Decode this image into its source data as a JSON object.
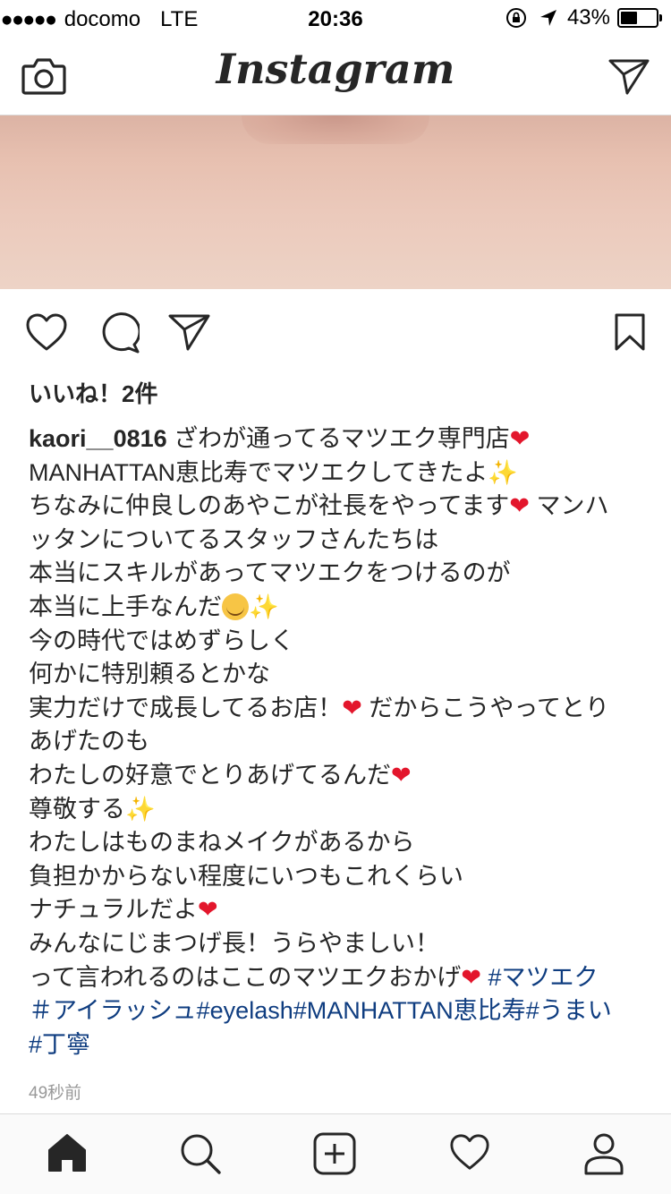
{
  "status_bar": {
    "signal": "●●●●●",
    "carrier": "docomo",
    "network": "LTE",
    "time": "20:36",
    "battery_percent": "43%",
    "battery_level": 0.43
  },
  "header": {
    "title": "Instagram",
    "left_icon": "camera-icon",
    "right_icon": "direct-message-icon"
  },
  "post": {
    "actions": [
      "like-icon",
      "comment-icon",
      "share-icon",
      "bookmark-icon"
    ],
    "likes_text": "いいね！2件",
    "caption": {
      "username": "kaori__0816",
      "line1_text": " ざわが通ってるマツエク専門店",
      "line2_text": "MANHATTAN恵比寿でマツエクしてきたよ",
      "line3a_text": "ちなみに仲良しのあやこが社長をやってます",
      "line3b_text": " マンハ",
      "line4_text": "ッタンについてるスタッフさんたちは",
      "line5_text": "本当にスキルがあってマツエクをつけるのが",
      "line6_text": "本当に上手なんだ",
      "line7_text": "今の時代ではめずらしく",
      "line8_text": "何かに特別頼るとかな",
      "line9a_text": "実力だけで成長してるお店！",
      "line9b_text": " だからこうやってとり",
      "line10_text": "あげたのも",
      "line11_text": "わたしの好意でとりあげてるんだ",
      "line12_text": "尊敬する",
      "line13_text": "わたしはものまねメイクがあるから",
      "line14_text": "負担かからない程度にいつもこれくらい",
      "line15_text": "ナチュラルだよ",
      "line16_text": "みんなにじまつげ長！うらやましい！",
      "line17_text": "って言われるのはここのマツエクおかげ",
      "tag1": " #マツエク",
      "line18_tag_a": "＃アイラッシュ#eyelash#MANHATTAN恵比寿#うまい",
      "line19_tag": "#丁寧",
      "heart_glyph": "❤",
      "sparkle_glyph": "✨"
    },
    "timestamp": "49秒前"
  },
  "tab_bar": {
    "items": [
      "home-icon",
      "search-icon",
      "add-post-icon",
      "activity-icon",
      "profile-icon"
    ]
  }
}
